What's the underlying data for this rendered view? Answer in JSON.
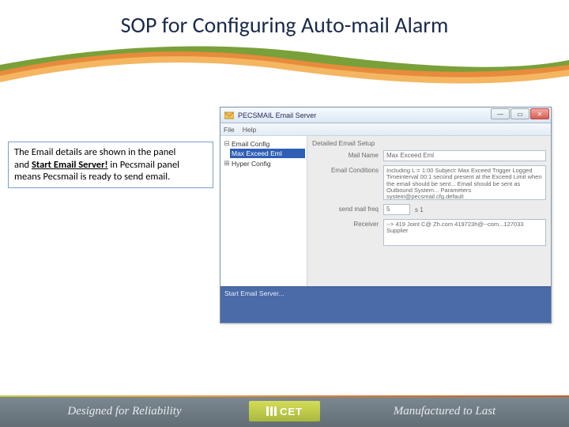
{
  "title": "SOP for Configuring Auto-mail Alarm",
  "callout": {
    "line1": "The Email details are shown in the panel",
    "line2_pre": "and ",
    "line2_u": "Start Email Server!",
    "line2_post": " in Pecsmail panel",
    "line3": "means Pecsmail is ready to send email."
  },
  "app": {
    "window_title": "PECSMAIL Email Server",
    "window_buttons": {
      "min": "—",
      "max": "▭",
      "close": "✕"
    },
    "menu": {
      "file": "File",
      "help": "Help"
    },
    "tree": {
      "root": "Email Config",
      "selected": "Max Exceed Eml",
      "other": "Hyper Config"
    },
    "form": {
      "heading": "Detailed Email Setup",
      "mail_name_label": "Mail Name",
      "mail_name_value": "Max Exceed Eml",
      "conditions_label": "Email Conditions",
      "conditions_value": "Including L:= 1:00\nSubject: Max Exceed Trigger Logged Timeinterval 00:1 second present at the Exceed Limit when the email should be sent...\nEmail should be sent as Outbound System...\nParameters system@pecsmail.cfg.default",
      "send_rate_label": "send mail freq",
      "send_rate_value": "5",
      "send_rate_unit": "s  1",
      "receiver_label": "Receiver",
      "receiver_value": "--> 419 Joint C@ Zh.com\n419723h@--com...127033 Supplier"
    },
    "status": {
      "line1": "Start Email Server..."
    }
  },
  "footer": {
    "left": "Designed for Reliability",
    "logo": "CET",
    "right": "Manufactured to Last"
  }
}
